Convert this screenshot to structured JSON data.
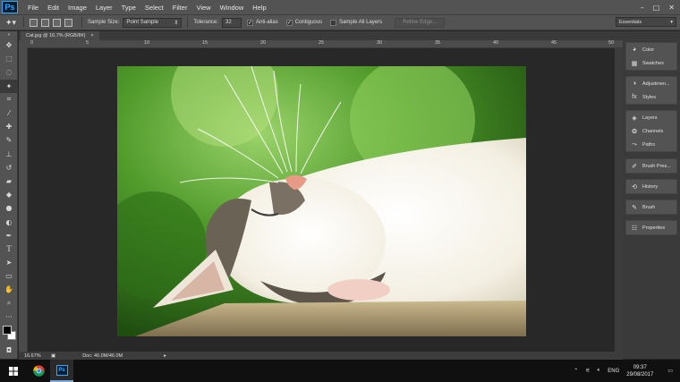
{
  "menubar": {
    "logo": "Ps",
    "items": [
      "File",
      "Edit",
      "Image",
      "Layer",
      "Type",
      "Select",
      "Filter",
      "View",
      "Window",
      "Help"
    ],
    "window_controls": [
      "–",
      "□",
      "✕"
    ]
  },
  "options": {
    "sample_size_label": "Sample Size:",
    "sample_size_value": "Point Sample",
    "tolerance_label": "Tolerance:",
    "tolerance_value": "32",
    "anti_alias_label": "Anti-alias",
    "anti_alias_checked": true,
    "contiguous_label": "Contiguous",
    "contiguous_checked": true,
    "sample_all_layers_label": "Sample All Layers",
    "sample_all_layers_checked": false,
    "refine_edge_label": "Refine Edge...",
    "workspace_value": "Essentials"
  },
  "document": {
    "tab_label": "Cat.jpg @ 16.7% (RGB/8#)",
    "tab_close": "×",
    "ruler_marks": [
      "0",
      "5",
      "10",
      "15",
      "20",
      "25",
      "30",
      "35",
      "40",
      "45",
      "50"
    ],
    "zoom": "16.67%",
    "doc_info": "Doc: 46.0M/46.0M"
  },
  "panels": {
    "group1": [
      "Color",
      "Swatches"
    ],
    "group2": [
      "Adjustmen...",
      "Styles"
    ],
    "group3": [
      "Layers",
      "Channels",
      "Paths"
    ],
    "group4": [
      "Brush Pres..."
    ],
    "group5": [
      "History"
    ],
    "group6": [
      "Brush"
    ],
    "group7": [
      "Properties"
    ]
  },
  "taskbar": {
    "language": "ENG",
    "time": "09:37",
    "date": "29/08/2017"
  },
  "colors": {
    "foreground": "#000000",
    "background": "#ffffff",
    "ps_blue": "#31a8ff"
  }
}
